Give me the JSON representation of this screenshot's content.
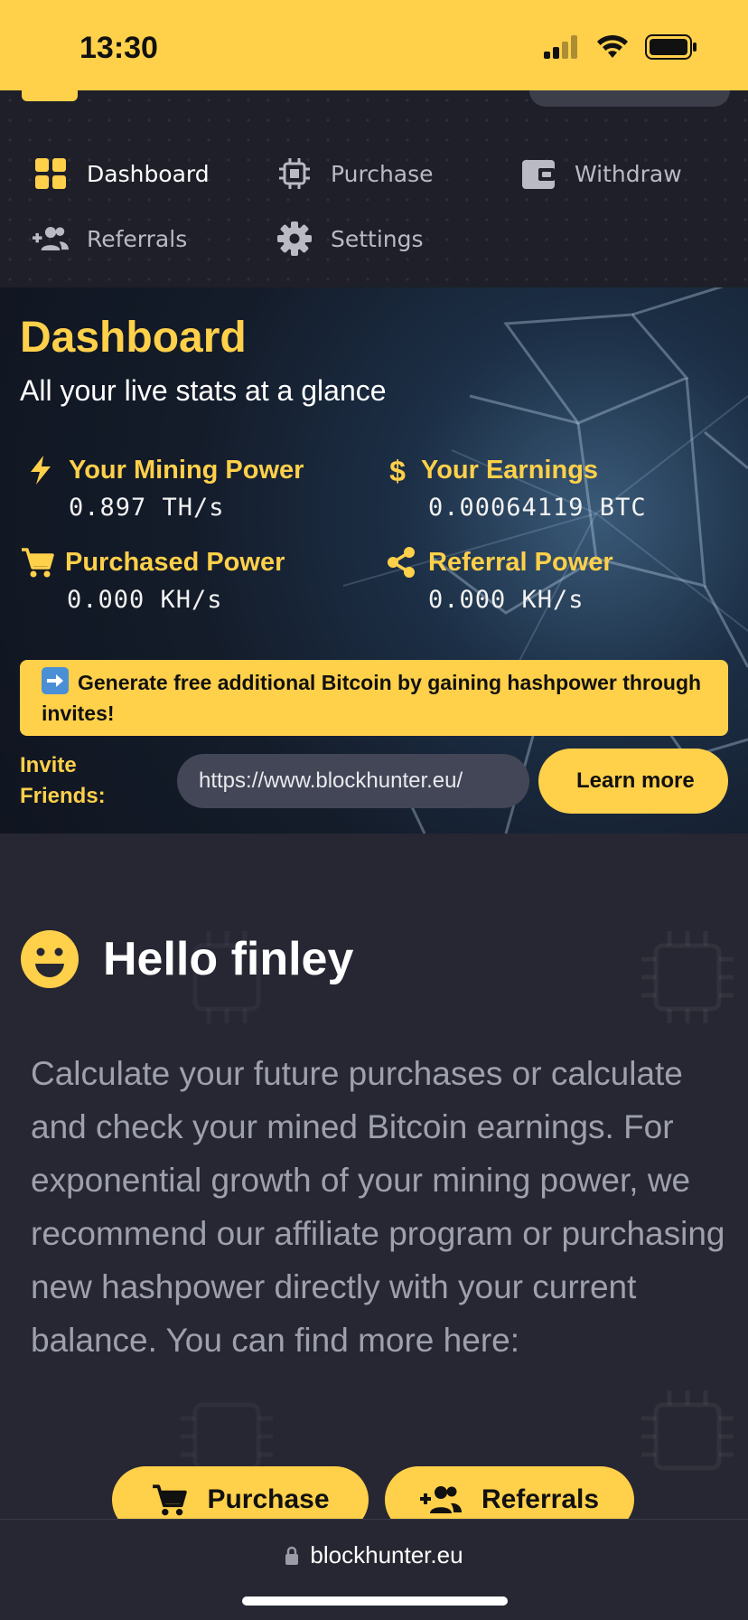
{
  "status_bar": {
    "time": "13:30",
    "signal_icon": "cellular-signal-icon",
    "wifi_icon": "wifi-icon",
    "battery_icon": "battery-icon"
  },
  "nav": {
    "items": [
      {
        "label": "Dashboard",
        "icon": "grid-icon",
        "active": true
      },
      {
        "label": "Purchase",
        "icon": "chip-icon",
        "active": false
      },
      {
        "label": "Withdraw",
        "icon": "wallet-icon",
        "active": false
      },
      {
        "label": "Referrals",
        "icon": "add-group-icon",
        "active": false
      },
      {
        "label": "Settings",
        "icon": "gear-icon",
        "active": false
      }
    ]
  },
  "hero": {
    "title": "Dashboard",
    "subtitle": "All your live stats at a glance",
    "stats": [
      {
        "label": "Your Mining Power",
        "value": "0.897 TH/s",
        "icon": "lightning-icon"
      },
      {
        "label": "Your Earnings",
        "value": "0.00064119 BTC",
        "icon": "dollar-icon"
      },
      {
        "label": "Purchased Power",
        "value": "0.000 KH/s",
        "icon": "cart-icon"
      },
      {
        "label": "Referral Power",
        "value": "0.000 KH/s",
        "icon": "share-icon"
      }
    ],
    "promo_text": "Generate free additional Bitcoin by gaining hashpower through invites!",
    "invite_label": "Invite Friends:",
    "invite_url": "https://www.blockhunter.eu/",
    "learn_more_label": "Learn more"
  },
  "content": {
    "greeting": "Hello finley",
    "intro": "Calculate your future purchases or calculate and check your mined Bitcoin earnings. For exponential growth of your mining power, we recommend our affiliate program or purchasing new hashpower directly with your current balance. You can find more here:",
    "purchase_button": "Purchase",
    "referrals_button": "Referrals"
  },
  "browser": {
    "url": "blockhunter.eu"
  },
  "colors": {
    "accent": "#FFD04A",
    "background": "#262732",
    "nav_background": "#1e1f28",
    "text_muted": "#9ea0ac"
  }
}
